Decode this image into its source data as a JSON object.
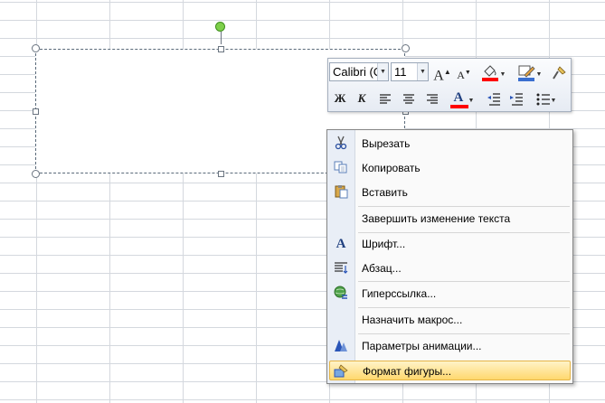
{
  "toolbar": {
    "font_name": "Calibri (С",
    "font_size": "11",
    "grow_font": "A",
    "shrink_font": "A",
    "bold": "Ж",
    "italic": "К",
    "font_color_letter": "A"
  },
  "context_menu": {
    "items": [
      {
        "label": "Вырезать",
        "icon": "scissors-icon"
      },
      {
        "label": "Копировать",
        "icon": "copy-icon"
      },
      {
        "label": "Вставить",
        "icon": "paste-icon"
      },
      {
        "label": "Завершить изменение текста",
        "icon": ""
      },
      {
        "label": "Шрифт...",
        "icon": "font-icon"
      },
      {
        "label": "Абзац...",
        "icon": "paragraph-icon"
      },
      {
        "label": "Гиперссылка...",
        "icon": "hyperlink-icon"
      },
      {
        "label": "Назначить макрос...",
        "icon": ""
      },
      {
        "label": "Параметры анимации...",
        "icon": "animation-icon"
      },
      {
        "label": "Формат фигуры...",
        "icon": "format-shape-icon"
      }
    ],
    "highlighted_index": 9
  },
  "colors": {
    "highlight_fill": "#ff0000",
    "font_color": "#ff0000",
    "outline_color": "#3a6fd0",
    "rotate_handle": "#7ed04a"
  }
}
